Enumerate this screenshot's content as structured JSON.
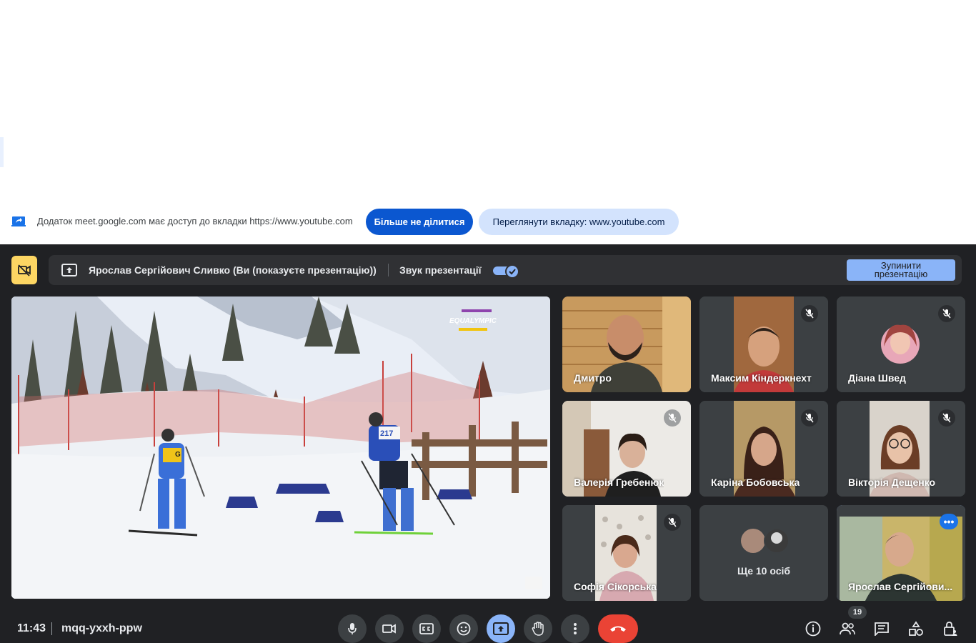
{
  "share_notice": {
    "text": "Додаток meet.google.com має доступ до вкладки https://www.youtube.com",
    "stop_sharing_label": "Більше не ділитися",
    "view_tab_label": "Переглянути вкладку: www.youtube.com"
  },
  "presentation_bar": {
    "title": "Ярослав Сергійович Сливко (Ви (показуєте презентацію))",
    "audio_label": "Звук презентації",
    "audio_enabled": true,
    "stop_presenting_label": "Зупинити презентацію"
  },
  "main_video": {
    "overlay_logo_text": "EQUALYMPIC",
    "bib_numbers": [
      "G",
      "217"
    ]
  },
  "participants": [
    {
      "name": "Дмитро",
      "muted": false
    },
    {
      "name": "Максим Кіндеркнехт",
      "muted": true
    },
    {
      "name": "Діана Швед",
      "muted": true
    },
    {
      "name": "Валерія Гребенюк",
      "muted": true
    },
    {
      "name": "Каріна Бобовська",
      "muted": true
    },
    {
      "name": "Вікторія Дещенко",
      "muted": true
    },
    {
      "name": "Софія Сікорська",
      "muted": true
    },
    {
      "name": "Ще 10 осіб",
      "muted": false
    },
    {
      "name": "Ярослав Сергійови...",
      "muted": false
    }
  ],
  "bottom_bar": {
    "time": "11:43",
    "meeting_code": "mqq-yxxh-ppw",
    "people_count": "19"
  },
  "colors": {
    "meet_bg": "#202124",
    "accent_blue": "#8ab4f8",
    "button_blue": "#0b57d0",
    "leave_red": "#ea4335",
    "present_yellow": "#fdd663"
  },
  "icons": {
    "share_tab": "screen-share-icon",
    "present": "present-to-all-icon",
    "mic": "mic-icon",
    "camera": "videocam-icon",
    "captions": "closed-caption-icon",
    "emoji": "emoji-icon",
    "raise_hand": "hand-icon",
    "more": "more-vert-icon",
    "leave": "call-end-icon",
    "info": "info-icon",
    "people": "people-icon",
    "chat": "chat-icon",
    "activities": "shapes-icon",
    "host_controls": "lock-person-icon"
  }
}
